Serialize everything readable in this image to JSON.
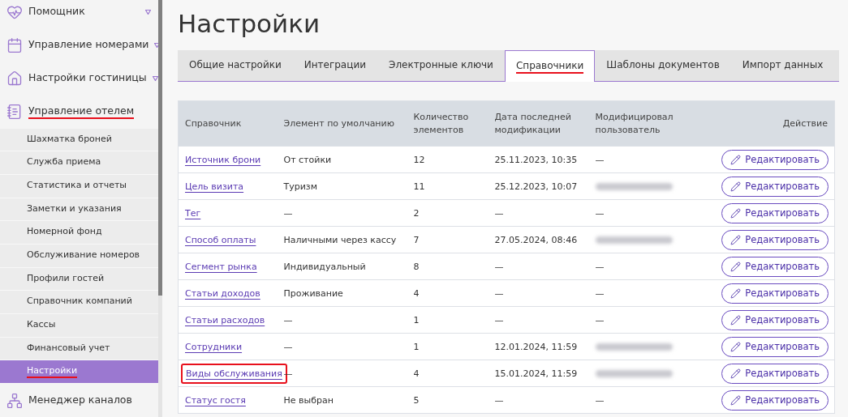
{
  "sidebar": {
    "sections": [
      {
        "label": "Помощник",
        "expandable": true,
        "annotated": false
      },
      {
        "label": "Управление номерами",
        "expandable": true,
        "annotated": false
      },
      {
        "label": "Настройки гостиницы",
        "expandable": true,
        "annotated": false
      },
      {
        "label": "Управление отелем",
        "expandable": false,
        "annotated": true,
        "children": [
          {
            "label": "Шахматка броней",
            "selected": false,
            "annotated": false
          },
          {
            "label": "Служба приема",
            "selected": false,
            "annotated": false
          },
          {
            "label": "Статистика и отчеты",
            "selected": false,
            "annotated": false
          },
          {
            "label": "Заметки и указания",
            "selected": false,
            "annotated": false
          },
          {
            "label": "Номерной фонд",
            "selected": false,
            "annotated": false
          },
          {
            "label": "Обслуживание номеров",
            "selected": false,
            "annotated": false
          },
          {
            "label": "Профили гостей",
            "selected": false,
            "annotated": false
          },
          {
            "label": "Справочник компаний",
            "selected": false,
            "annotated": false
          },
          {
            "label": "Кассы",
            "selected": false,
            "annotated": false
          },
          {
            "label": "Финансовый учет",
            "selected": false,
            "annotated": false
          },
          {
            "label": "Настройки",
            "selected": true,
            "annotated": true
          }
        ]
      },
      {
        "label": "Менеджер каналов",
        "expandable": false,
        "annotated": false
      }
    ]
  },
  "page": {
    "title": "Настройки"
  },
  "tabs": [
    {
      "label": "Общие настройки",
      "selected": false,
      "annotated": false
    },
    {
      "label": "Интеграции",
      "selected": false,
      "annotated": false
    },
    {
      "label": "Электронные ключи",
      "selected": false,
      "annotated": false
    },
    {
      "label": "Справочники",
      "selected": true,
      "annotated": true
    },
    {
      "label": "Шаблоны документов",
      "selected": false,
      "annotated": false
    },
    {
      "label": "Импорт данных",
      "selected": false,
      "annotated": false
    }
  ],
  "table": {
    "columns": [
      "Справочник",
      "Элемент по умолчанию",
      "Количество элементов",
      "Дата последней модификации",
      "Модифицировал пользователь",
      "Действие"
    ],
    "rows": [
      {
        "name": "Источник брони",
        "default": "От стойки",
        "count": "12",
        "date": "25.11.2023, 10:35",
        "user": "—",
        "user_hidden": false,
        "boxed": false,
        "action": "Редактировать"
      },
      {
        "name": "Цель визита",
        "default": "Туризм",
        "count": "11",
        "date": "25.12.2023, 10:07",
        "user_hidden": true,
        "boxed": false,
        "action": "Редактировать"
      },
      {
        "name": "Тег",
        "default": "—",
        "count": "2",
        "date": "—",
        "user": "—",
        "user_hidden": false,
        "boxed": false,
        "action": "Редактировать"
      },
      {
        "name": "Способ оплаты",
        "default": "Наличными через кассу",
        "count": "7",
        "date": "27.05.2024, 08:46",
        "user_hidden": true,
        "boxed": false,
        "action": "Редактировать"
      },
      {
        "name": "Сегмент рынка",
        "default": "Индивидуальный",
        "count": "8",
        "date": "—",
        "user": "—",
        "user_hidden": false,
        "boxed": false,
        "action": "Редактировать"
      },
      {
        "name": "Статьи доходов",
        "default": "Проживание",
        "count": "4",
        "date": "—",
        "user": "—",
        "user_hidden": false,
        "boxed": false,
        "action": "Редактировать"
      },
      {
        "name": "Статьи расходов",
        "default": "—",
        "count": "1",
        "date": "—",
        "user": "—",
        "user_hidden": false,
        "boxed": false,
        "action": "Редактировать"
      },
      {
        "name": "Сотрудники",
        "default": "—",
        "count": "1",
        "date": "12.01.2024, 11:59",
        "user_hidden": true,
        "boxed": false,
        "action": "Редактировать"
      },
      {
        "name": "Виды обслуживания",
        "default": "—",
        "count": "4",
        "date": "15.01.2024, 11:59",
        "user_hidden": true,
        "boxed": true,
        "action": "Редактировать"
      },
      {
        "name": "Статус гостя",
        "default": "Не выбран",
        "count": "5",
        "date": "—",
        "user": "—",
        "user_hidden": false,
        "boxed": false,
        "action": "Редактировать"
      }
    ]
  }
}
